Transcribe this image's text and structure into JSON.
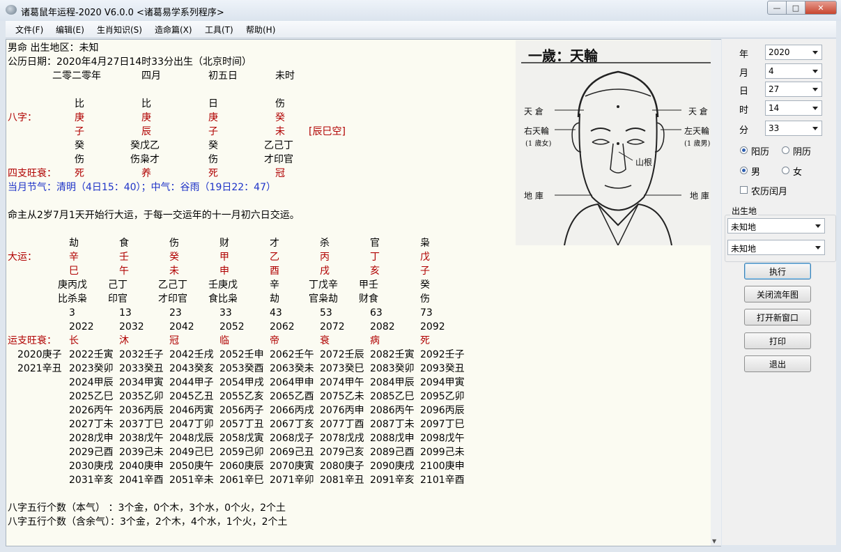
{
  "window": {
    "title": "诸葛鼠年运程-2020  V6.0.0  <诸葛易学系列程序>",
    "min_glyph": "—",
    "max_glyph": "□",
    "close_glyph": "✕"
  },
  "menu": [
    "文件(F)",
    "编辑(E)",
    "生肖知识(S)",
    "造命篇(X)",
    "工具(T)",
    "帮助(H)"
  ],
  "header": {
    "line1": "男命   出生地区：未知",
    "line2": "公历日期：2020年4月27日14时33分出生（北京时间）",
    "lunar": [
      "二零二零年",
      "四月",
      "初五日",
      "未时"
    ]
  },
  "bazi": {
    "shishen": [
      "比",
      "比",
      "日",
      "伤"
    ],
    "label": "八字：",
    "stems": [
      "庚",
      "庚",
      "庚",
      "癸"
    ],
    "branches": [
      "子",
      "辰",
      "子",
      "未"
    ],
    "kong": "[辰巳空]",
    "hidden": [
      "癸",
      "癸戊乙",
      "癸",
      "乙己丁"
    ],
    "hidden_shishen": [
      "伤",
      "伤枭才",
      "伤",
      "才印官"
    ],
    "wangshuai_label": "四支旺衰：",
    "wangshuai": [
      "死",
      "养",
      "死",
      "冠"
    ]
  },
  "jieqi": "当月节气：清明（4日15：40）；中气：谷雨（19日22：47）",
  "qiyun": "命主从2岁7月1天开始行大运，于每一交运年的十一月初六日交运。",
  "dayun": {
    "shishen": [
      "劫",
      "食",
      "伤",
      "财",
      "才",
      "杀",
      "官",
      "枭"
    ],
    "label": "大运：",
    "stems": [
      "辛",
      "壬",
      "癸",
      "甲",
      "乙",
      "丙",
      "丁",
      "戊"
    ],
    "branches": [
      "巳",
      "午",
      "未",
      "申",
      "酉",
      "戌",
      "亥",
      "子"
    ],
    "hidden": [
      "庚丙戊",
      "己丁",
      "乙己丁",
      "壬庚戊",
      "辛",
      "丁戊辛",
      "甲壬",
      "癸"
    ],
    "hidden_shishen": [
      "比杀枭",
      "印官",
      "才印官",
      "食比枭",
      "劫",
      "官枭劫",
      "财食",
      "伤"
    ],
    "ages": [
      "3",
      "13",
      "23",
      "33",
      "43",
      "53",
      "63",
      "73"
    ],
    "years": [
      "2022",
      "2032",
      "2042",
      "2052",
      "2062",
      "2072",
      "2082",
      "2092"
    ],
    "wangshuai_label": "运支旺衰：",
    "wangshuai": [
      "长",
      "沐",
      "冠",
      "临",
      "帝",
      "衰",
      "病",
      "死"
    ]
  },
  "liunian": {
    "pre": [
      "2020庚子",
      "2021辛丑"
    ],
    "columns": [
      [
        "2022壬寅",
        "2023癸卯",
        "2024甲辰",
        "2025乙巳",
        "2026丙午",
        "2027丁未",
        "2028戊申",
        "2029己酉",
        "2030庚戌",
        "2031辛亥"
      ],
      [
        "2032壬子",
        "2033癸丑",
        "2034甲寅",
        "2035乙卯",
        "2036丙辰",
        "2037丁巳",
        "2038戊午",
        "2039己未",
        "2040庚申",
        "2041辛酉"
      ],
      [
        "2042壬戌",
        "2043癸亥",
        "2044甲子",
        "2045乙丑",
        "2046丙寅",
        "2047丁卯",
        "2048戊辰",
        "2049己巳",
        "2050庚午",
        "2051辛未"
      ],
      [
        "2052壬申",
        "2053癸酉",
        "2054甲戌",
        "2055乙亥",
        "2056丙子",
        "2057丁丑",
        "2058戊寅",
        "2059己卯",
        "2060庚辰",
        "2061辛巳"
      ],
      [
        "2062壬午",
        "2063癸未",
        "2064甲申",
        "2065乙酉",
        "2066丙戌",
        "2067丁亥",
        "2068戊子",
        "2069己丑",
        "2070庚寅",
        "2071辛卯"
      ],
      [
        "2072壬辰",
        "2073癸巳",
        "2074甲午",
        "2075乙未",
        "2076丙申",
        "2077丁酉",
        "2078戊戌",
        "2079己亥",
        "2080庚子",
        "2081辛丑"
      ],
      [
        "2082壬寅",
        "2083癸卯",
        "2084甲辰",
        "2085乙巳",
        "2086丙午",
        "2087丁未",
        "2088戊申",
        "2089己酉",
        "2090庚戌",
        "2091辛亥"
      ],
      [
        "2092壬子",
        "2093癸丑",
        "2094甲寅",
        "2095乙卯",
        "2096丙辰",
        "2097丁巳",
        "2098戊午",
        "2099己未",
        "2100庚申",
        "2101辛酉"
      ]
    ]
  },
  "wuxing": {
    "line1": "八字五行个数（本气）  ：3个金，0个木，3个水，0个火，2个土",
    "line2": "八字五行个数（含余气）：3个金，2个木，4个水，1个火，2个土"
  },
  "face_image": {
    "title": "一歲：天輪",
    "labels": {
      "tiancang_left": "天 倉",
      "tiancang_right": "天 倉",
      "youtianlun": "右天輪",
      "youtianlun_sub": "(1 歲女)",
      "zuotianlun": "左天輪",
      "zuotianlun_sub": "(1 歲男)",
      "shangen": "山根",
      "diku_left": "地 庫",
      "diku_right": "地 庫"
    }
  },
  "form": {
    "year_label": "年",
    "year_value": "2020",
    "month_label": "月",
    "month_value": "4",
    "day_label": "日",
    "day_value": "27",
    "hour_label": "时",
    "hour_value": "14",
    "minute_label": "分",
    "minute_value": "33",
    "calendar_solar": "阳历",
    "calendar_lunar": "阴历",
    "gender_male": "男",
    "gender_female": "女",
    "leap_month": "农历闰月",
    "birthplace_label": "出生地",
    "birthplace_1": "未知地",
    "birthplace_2": "未知地"
  },
  "buttons": {
    "execute": "执行",
    "close_chart": "关闭流年图",
    "new_window": "打开新窗口",
    "print": "打印",
    "exit": "退出"
  }
}
